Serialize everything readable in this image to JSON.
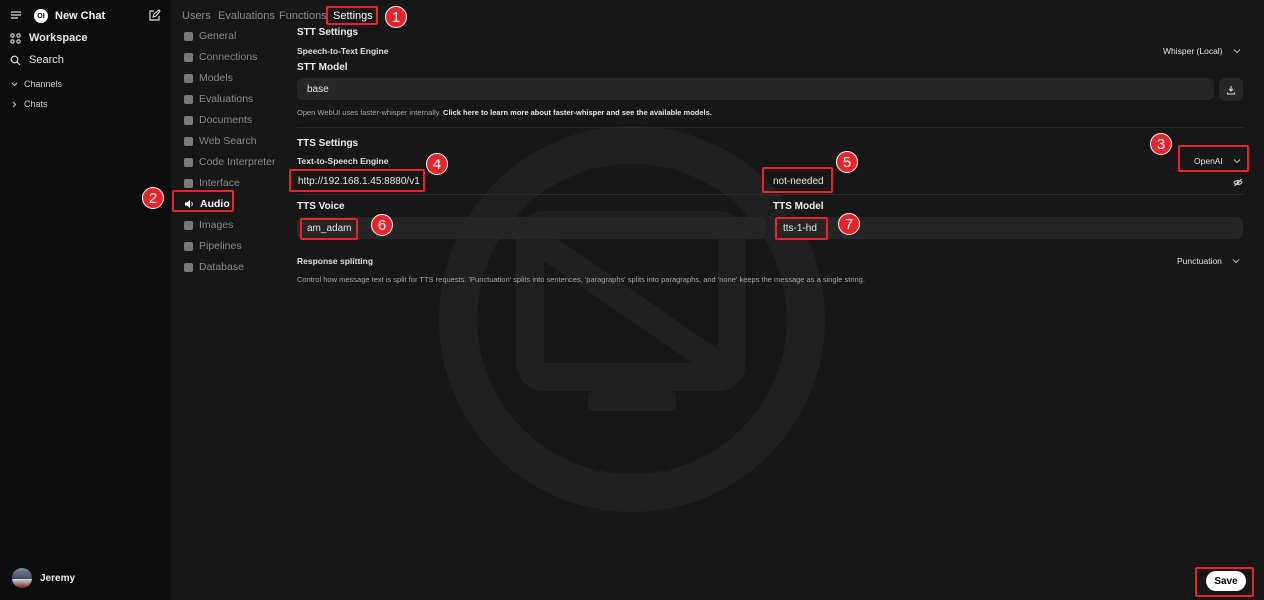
{
  "sidebar": {
    "new_chat_label": "New Chat",
    "logo_text": "OI",
    "workspace_label": "Workspace",
    "search_label": "Search",
    "channels_label": "Channels",
    "chats_label": "Chats",
    "user_name": "Jeremy"
  },
  "tabs": [
    {
      "label": "Users"
    },
    {
      "label": "Evaluations"
    },
    {
      "label": "Functions"
    },
    {
      "label": "Settings",
      "active": true
    }
  ],
  "settings_nav": [
    {
      "label": "General",
      "icon": "gear-icon"
    },
    {
      "label": "Connections",
      "icon": "cloud-icon"
    },
    {
      "label": "Models",
      "icon": "stack-icon"
    },
    {
      "label": "Evaluations",
      "icon": "document-icon"
    },
    {
      "label": "Documents",
      "icon": "document-icon"
    },
    {
      "label": "Web Search",
      "icon": "globe-icon"
    },
    {
      "label": "Code Interpreter",
      "icon": "terminal-icon"
    },
    {
      "label": "Interface",
      "icon": "monitor-icon"
    },
    {
      "label": "Audio",
      "icon": "speaker-icon",
      "active": true
    },
    {
      "label": "Images",
      "icon": "image-icon"
    },
    {
      "label": "Pipelines",
      "icon": "layers-icon"
    },
    {
      "label": "Database",
      "icon": "database-icon"
    }
  ],
  "stt": {
    "section_title": "STT Settings",
    "engine_label": "Speech-to-Text Engine",
    "engine_value": "Whisper (Local)",
    "model_title": "STT Model",
    "model_value": "base",
    "help_prefix": "Open WebUI uses faster-whisper internally.",
    "help_link": "Click here to learn more about faster-whisper and see the available models."
  },
  "tts": {
    "section_title": "TTS Settings",
    "engine_label": "Text-to-Speech Engine",
    "engine_value": "OpenAI",
    "api_base_url": "http://192.168.1.45:8880/v1",
    "api_key": "not-needed",
    "voice_title": "TTS Voice",
    "voice_value": "am_adam",
    "model_title": "TTS Model",
    "model_value": "tts-1-hd",
    "splitting_label": "Response splitting",
    "splitting_value": "Punctuation",
    "splitting_desc": "Control how message text is split for TTS requests. 'Punctuation' splits into sentences, 'paragraphs' splits into paragraphs, and 'none' keeps the message as a single string."
  },
  "save_label": "Save",
  "annotations": [
    "1",
    "2",
    "3",
    "4",
    "5",
    "6",
    "7"
  ],
  "colors": {
    "annotation": "#e8232a",
    "background": "#171717",
    "sidebar": "#0d0d0d",
    "input": "#262626"
  }
}
